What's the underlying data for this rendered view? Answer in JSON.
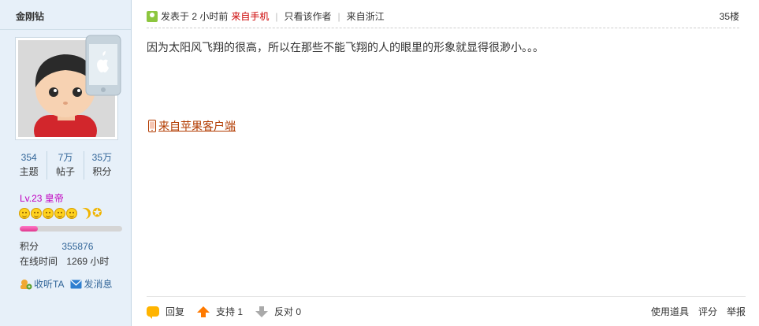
{
  "user": {
    "name": "金刚钻",
    "stats": [
      {
        "value": "354",
        "label": "主题"
      },
      {
        "value": "7万",
        "label": "帖子"
      },
      {
        "value": "35万",
        "label": "积分"
      }
    ],
    "level": "Lv.23 皇帝",
    "level_progress": 0.18,
    "points_label": "积分",
    "points_value": "355876",
    "online_label": "在线时间",
    "online_value": "1269 小时",
    "follow_label": "收听TA",
    "message_label": "发消息"
  },
  "post": {
    "posted_label": "发表于 2 小时前",
    "mobile_label": "来自手机",
    "only_author_label": "只看该作者",
    "location": "来自浙江",
    "floor": "35楼",
    "content": "因为太阳风飞翔的很高，所以在那些不能飞翔的人的眼里的形象就显得很渺小。。。",
    "client_link": "来自苹果客户端"
  },
  "footer": {
    "reply_label": "回复",
    "support_label": "支持 1",
    "oppose_label": "反对 0",
    "tools_label": "使用道具",
    "rate_label": "评分",
    "report_label": "举报"
  },
  "colors": {
    "sidebar_bg": "#e7f0f9",
    "link_blue": "#336699",
    "mobile_red": "#cc0000",
    "level_purple": "#c000c0",
    "progress_pink": "#e0388e"
  }
}
